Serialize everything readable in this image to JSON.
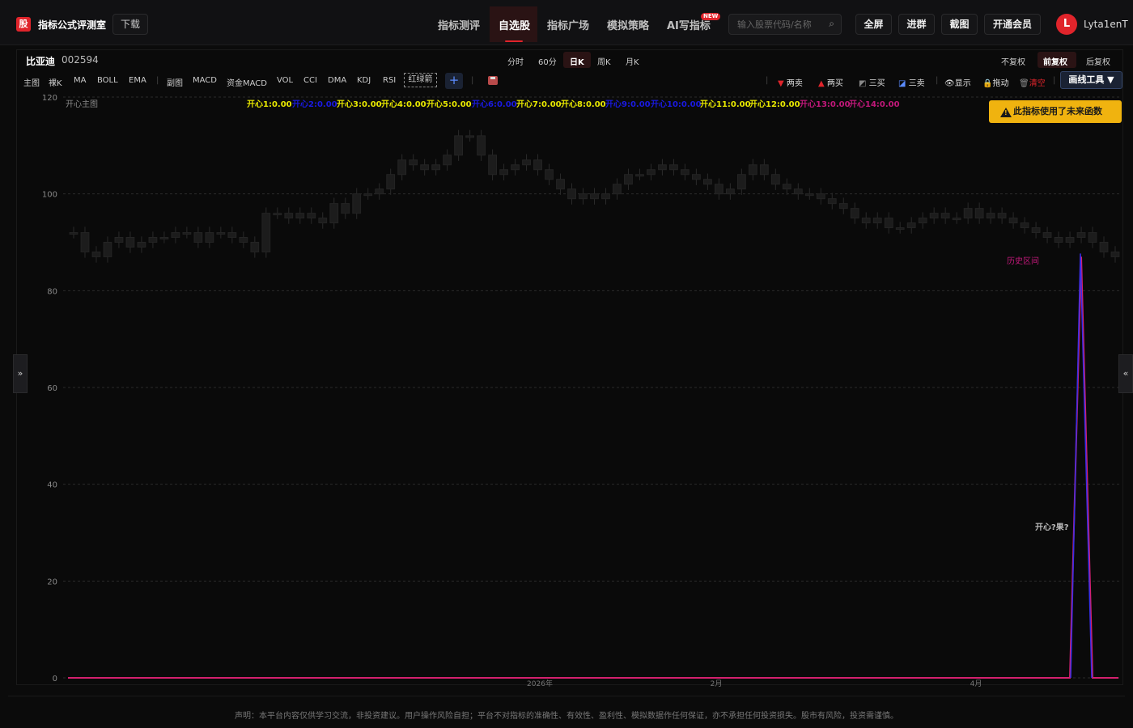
{
  "header": {
    "logo_char": "股",
    "site_title": "指标公式评测室",
    "download": "下载",
    "nav": [
      "指标测评",
      "自选股",
      "指标广场",
      "模拟策略",
      "AI写指标"
    ],
    "new_badge": "NEW",
    "search_placeholder": "输入股票代码/名称",
    "buttons": [
      "全屏",
      "进群",
      "截图",
      "开通会员"
    ],
    "avatar_letter": "L",
    "username": "Lyta1enT"
  },
  "stock": {
    "name": "比亚迪",
    "code": "002594"
  },
  "periods": [
    "分时",
    "60分",
    "日K",
    "周K",
    "月K"
  ],
  "active_period": "日K",
  "fq_options": [
    "不复权",
    "前复权",
    "后复权"
  ],
  "active_fq": "前复权",
  "indicators_main_label": "主图",
  "indicators_main": [
    "裸K",
    "MA",
    "BOLL",
    "EMA"
  ],
  "indicators_sub_label": "副图",
  "indicators_sub": [
    "MACD",
    "资金MACD",
    "VOL",
    "CCI",
    "DMA",
    "KDJ",
    "RSI"
  ],
  "hongl_button": "红绿箭",
  "tools": [
    "两卖",
    "两买",
    "三买",
    "三卖",
    "显示",
    "拖动",
    "清空"
  ],
  "draw_tool": "画线工具 ▼",
  "warning": "此指标使用了未来函数",
  "legend_prefix": "开心主图",
  "legend_items": [
    {
      "label": "开心1:0.00",
      "color": "#e8e800"
    },
    {
      "label": "开心2:0.00",
      "color": "#1a1ae0"
    },
    {
      "label": "开心3:0.00",
      "color": "#e8e800"
    },
    {
      "label": "开心4:0.00",
      "color": "#e8e800"
    },
    {
      "label": "开心5:0.00",
      "color": "#e8e800"
    },
    {
      "label": "开心6:0.00",
      "color": "#1a1ae0"
    },
    {
      "label": "开心7:0.00",
      "color": "#e8e800"
    },
    {
      "label": "开心8:0.00",
      "color": "#e8e800"
    },
    {
      "label": "开心9:0.00",
      "color": "#1a1ae0"
    },
    {
      "label": "开心10:0.00",
      "color": "#1a1ae0"
    },
    {
      "label": "开心11:0.00",
      "color": "#e8e800"
    },
    {
      "label": "开心12:0.00",
      "color": "#e8e800"
    },
    {
      "label": "开心13:0.00",
      "color": "#c2187a"
    },
    {
      "label": "开心14:0.00",
      "color": "#c2187a"
    }
  ],
  "annotations": {
    "history": "历史区间",
    "kaixin": "开心?果?"
  },
  "disclaimer": "声明：本平台内容仅供学习交流，非投资建议。用户操作风险自担；平台不对指标的准确性、有效性、盈利性、模拟数据作任何保证，亦不承担任何投资损失。股市有风险，投资需谨慎。",
  "chart_data": {
    "type": "candlestick",
    "ylim": [
      0,
      120
    ],
    "y_ticks": [
      0,
      20,
      40,
      60,
      80,
      100,
      120
    ],
    "x_ticks": [
      "2026年",
      "2月",
      "4月"
    ],
    "grid": true,
    "candles_close": [
      92,
      88,
      87,
      90,
      91,
      89,
      90,
      91,
      91,
      92,
      92,
      90,
      92,
      92,
      91,
      90,
      88,
      96,
      96,
      95,
      96,
      95,
      94,
      98,
      96,
      100,
      100,
      101,
      104,
      107,
      106,
      105,
      106,
      108,
      112,
      112,
      108,
      104,
      105,
      106,
      107,
      105,
      103,
      101,
      99,
      100,
      99,
      100,
      102,
      104,
      104,
      105,
      106,
      105,
      104,
      103,
      102,
      100,
      101,
      104,
      106,
      104,
      102,
      101,
      100,
      100,
      99,
      98,
      97,
      95,
      94,
      95,
      93,
      93,
      94,
      95,
      96,
      95,
      95,
      97,
      95,
      96,
      95,
      94,
      93,
      92,
      91,
      90,
      91,
      92,
      90,
      88,
      87
    ],
    "signal_line": {
      "name": "开心",
      "peak_value": 87,
      "peak_index_from_end": 7
    }
  }
}
